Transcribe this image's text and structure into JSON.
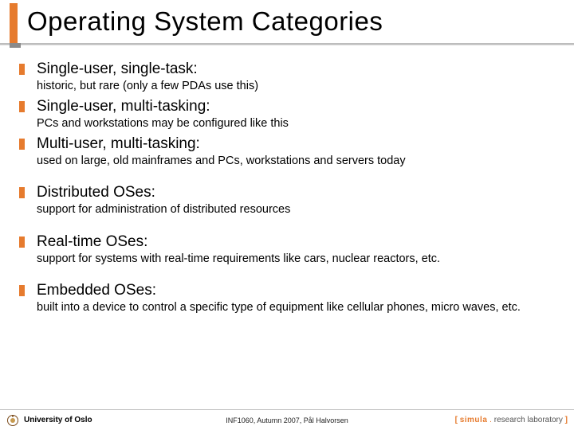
{
  "title": "Operating System Categories",
  "items": [
    {
      "heading": "Single-user, single-task:",
      "desc": "historic, but rare (only a few PDAs use this)"
    },
    {
      "heading": "Single-user, multi-tasking:",
      "desc": "PCs and workstations may be configured like this"
    },
    {
      "heading": "Multi-user, multi-tasking:",
      "desc": "used on large, old mainframes and PCs, workstations and servers today"
    },
    {
      "heading": "Distributed OSes:",
      "desc": "support for administration of distributed resources"
    },
    {
      "heading": "Real-time OSes:",
      "desc": "support for systems with real-time requirements like cars, nuclear reactors, etc."
    },
    {
      "heading": "Embedded OSes:",
      "desc": "built into a device to control a specific type of equipment like cellular phones, micro waves, etc."
    }
  ],
  "footer": {
    "university": "University of Oslo",
    "course": "INF1060, Autumn 2007, Pål Halvorsen",
    "lab_open": "[ ",
    "lab_name": "simula",
    "lab_dot": " . ",
    "lab_rest": "research laboratory",
    "lab_close": " ]"
  }
}
